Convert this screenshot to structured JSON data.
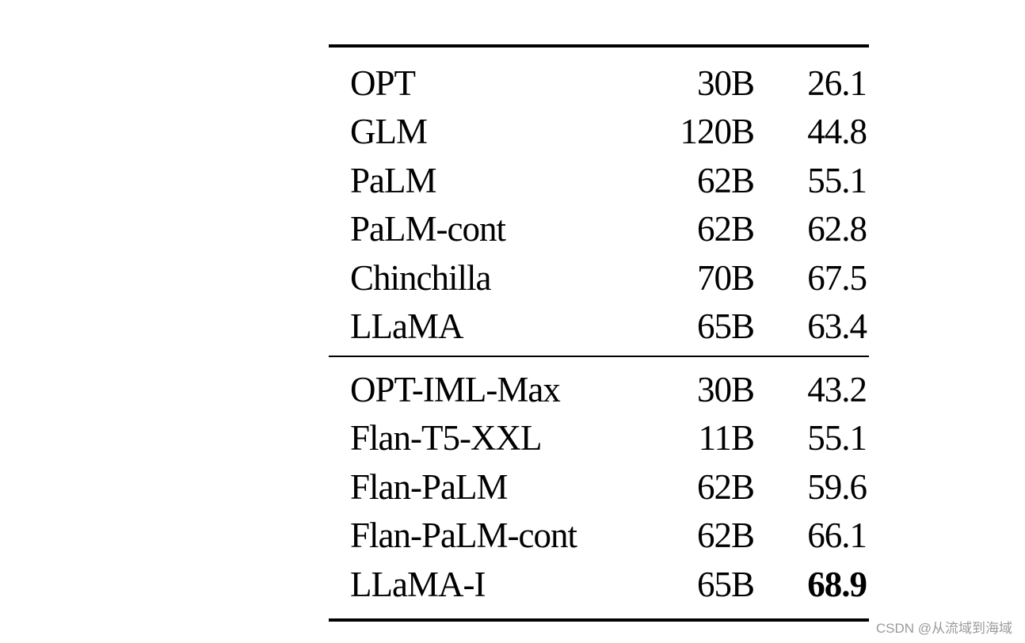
{
  "table": {
    "groups": [
      {
        "rows": [
          {
            "model": "OPT",
            "params": "30B",
            "score": "26.1",
            "bold": false
          },
          {
            "model": "GLM",
            "params": "120B",
            "score": "44.8",
            "bold": false
          },
          {
            "model": "PaLM",
            "params": "62B",
            "score": "55.1",
            "bold": false
          },
          {
            "model": "PaLM-cont",
            "params": "62B",
            "score": "62.8",
            "bold": false
          },
          {
            "model": "Chinchilla",
            "params": "70B",
            "score": "67.5",
            "bold": false
          },
          {
            "model": "LLaMA",
            "params": "65B",
            "score": "63.4",
            "bold": false
          }
        ]
      },
      {
        "rows": [
          {
            "model": "OPT-IML-Max",
            "params": "30B",
            "score": "43.2",
            "bold": false
          },
          {
            "model": "Flan-T5-XXL",
            "params": "11B",
            "score": "55.1",
            "bold": false
          },
          {
            "model": "Flan-PaLM",
            "params": "62B",
            "score": "59.6",
            "bold": false
          },
          {
            "model": "Flan-PaLM-cont",
            "params": "62B",
            "score": "66.1",
            "bold": false
          },
          {
            "model": "LLaMA-I",
            "params": "65B",
            "score": "68.9",
            "bold": true
          }
        ]
      }
    ]
  },
  "watermark": "CSDN @从流域到海域"
}
